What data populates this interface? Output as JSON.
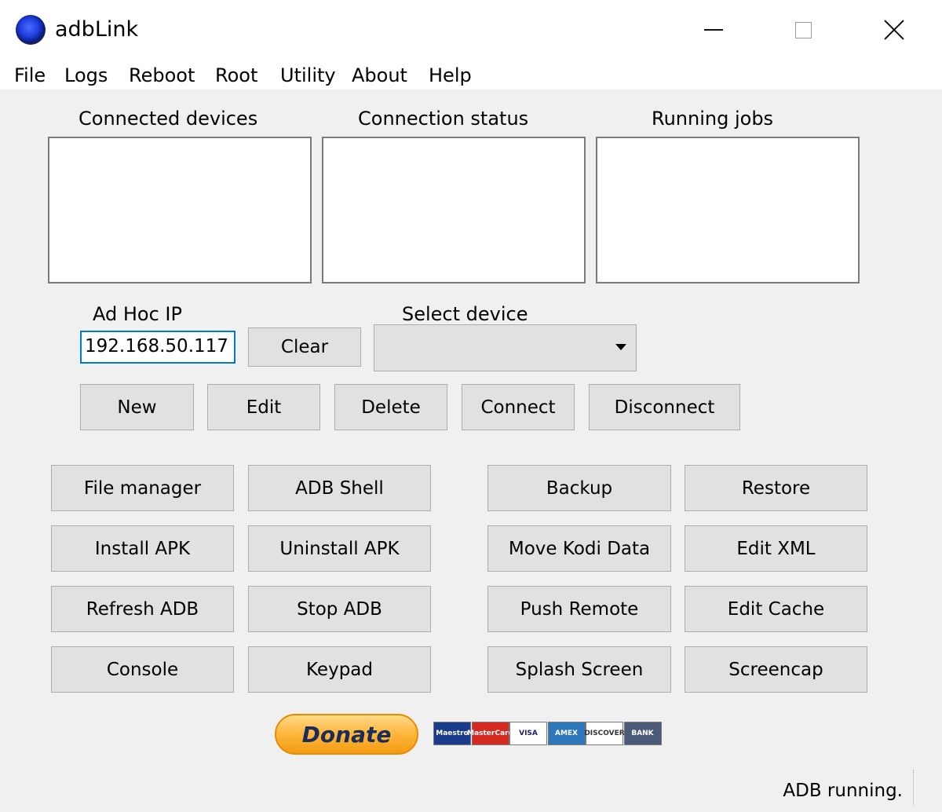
{
  "window": {
    "title": "adbLink",
    "controls": {
      "minimize_icon": "minimize-icon",
      "maximize_icon": "maximize-icon",
      "close_icon": "close-icon"
    }
  },
  "menu": {
    "items": [
      "File",
      "Logs",
      "Reboot",
      "Root",
      "Utility",
      "About",
      "Help"
    ]
  },
  "panels": {
    "connected_devices": "Connected devices",
    "connection_status": "Connection status",
    "running_jobs": "Running jobs"
  },
  "adhoc": {
    "label": "Ad Hoc IP",
    "value": "192.168.50.117",
    "clear_label": "Clear"
  },
  "select_device": {
    "label": "Select device",
    "value": ""
  },
  "device_buttons": [
    "New",
    "Edit",
    "Delete",
    "Connect",
    "Disconnect"
  ],
  "actions": {
    "left": [
      [
        "File manager",
        "ADB Shell"
      ],
      [
        "Install APK",
        "Uninstall APK"
      ],
      [
        "Refresh ADB",
        "Stop ADB"
      ],
      [
        "Console",
        "Keypad"
      ]
    ],
    "right": [
      [
        "Backup",
        "Restore"
      ],
      [
        "Move Kodi Data",
        "Edit XML"
      ],
      [
        "Push Remote",
        "Edit Cache"
      ],
      [
        "Splash Screen",
        "Screencap"
      ]
    ]
  },
  "donate": {
    "label": "Donate",
    "cards": [
      {
        "name": "maestro-card-icon",
        "text": "Maestro",
        "bg": "#1a3b8c",
        "fg": "#ffffff"
      },
      {
        "name": "mastercard-icon",
        "text": "MasterCard",
        "bg": "#d42a20",
        "fg": "#ffffff"
      },
      {
        "name": "visa-card-icon",
        "text": "VISA",
        "bg": "#ffffff",
        "fg": "#1a1f71"
      },
      {
        "name": "amex-card-icon",
        "text": "AMEX",
        "bg": "#2e77bb",
        "fg": "#ffffff"
      },
      {
        "name": "discover-card-icon",
        "text": "DISCOVER",
        "bg": "#ffffff",
        "fg": "#333333"
      },
      {
        "name": "bank-card-icon",
        "text": "BANK",
        "bg": "#4a5a78",
        "fg": "#ffffff"
      }
    ]
  },
  "status": {
    "text": "ADB running."
  }
}
